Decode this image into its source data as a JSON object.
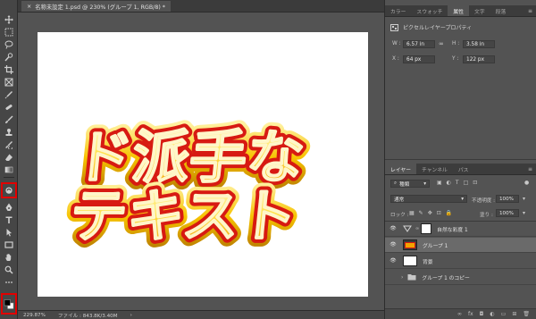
{
  "document": {
    "tab_title": "名称未設定 1.psd @ 230% (グループ 1, RGB/8) *",
    "canvas_text_line1": "ド派手な",
    "canvas_text_line2": "テキスト"
  },
  "status": {
    "zoom": "229.87%",
    "file_info": "ファイル : 843.8K/3.40M",
    "arrow": "›"
  },
  "properties_panel": {
    "tabs": [
      "カラー",
      "スウォッチ",
      "属性",
      "文字",
      "段落"
    ],
    "active_tab": "属性",
    "title": "ピクセルレイヤープロパティ",
    "w_label": "W :",
    "w_value": "6.57 in",
    "h_label": "H :",
    "h_value": "3.58 in",
    "x_label": "X :",
    "x_value": "64 px",
    "y_label": "Y :",
    "y_value": "122 px"
  },
  "layers_panel": {
    "tabs": [
      "レイヤー",
      "チャンネル",
      "パス"
    ],
    "active_tab": "レイヤー",
    "filter_label": "種類",
    "blend_mode": "通常",
    "opacity_label": "不透明度 :",
    "opacity_value": "100%",
    "lock_label": "ロック :",
    "fill_label": "塗り :",
    "fill_value": "100%",
    "layers": [
      {
        "name": "自然な彩度 1",
        "kind": "adjustment",
        "visible": true,
        "selected": false
      },
      {
        "name": "グループ 1",
        "kind": "text-group",
        "visible": true,
        "selected": true
      },
      {
        "name": "背景",
        "kind": "background",
        "visible": true,
        "selected": false
      },
      {
        "name": "グループ 1 のコピー",
        "kind": "folder",
        "visible": false,
        "selected": false
      }
    ],
    "footer_icons": [
      "link-icon",
      "fx-icon",
      "mask-icon",
      "adjustment-icon",
      "folder-icon",
      "new-layer-icon",
      "trash-icon"
    ],
    "footer_fx": "fx"
  },
  "colors": {
    "highlight": "#e10000",
    "text_fill_top": "#fff7b0",
    "text_fill_bottom": "#f2a300",
    "text_stroke_inner": "#d71a12",
    "text_stroke_outer": "#f6c400"
  }
}
